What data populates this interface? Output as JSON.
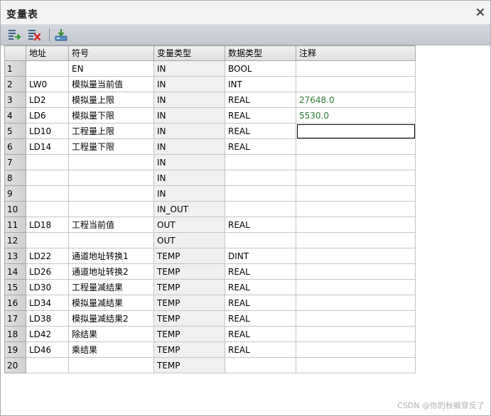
{
  "window": {
    "title": "变量表"
  },
  "table": {
    "headers": [
      "",
      "地址",
      "符号",
      "变量类型",
      "数据类型",
      "注释"
    ],
    "rows": [
      {
        "num": "1",
        "address": "",
        "symbol": "EN",
        "var_type": "IN",
        "data_type": "BOOL",
        "comment": ""
      },
      {
        "num": "2",
        "address": "LW0",
        "symbol": "模拟量当前值",
        "var_type": "IN",
        "data_type": "INT",
        "comment": ""
      },
      {
        "num": "3",
        "address": "LD2",
        "symbol": "模拟量上限",
        "var_type": "IN",
        "data_type": "REAL",
        "comment": "27648.0"
      },
      {
        "num": "4",
        "address": "LD6",
        "symbol": "模拟量下限",
        "var_type": "IN",
        "data_type": "REAL",
        "comment": "5530.0"
      },
      {
        "num": "5",
        "address": "LD10",
        "symbol": "工程量上限",
        "var_type": "IN",
        "data_type": "REAL",
        "comment": ""
      },
      {
        "num": "6",
        "address": "LD14",
        "symbol": "工程量下限",
        "var_type": "IN",
        "data_type": "REAL",
        "comment": ""
      },
      {
        "num": "7",
        "address": "",
        "symbol": "",
        "var_type": "IN",
        "data_type": "",
        "comment": ""
      },
      {
        "num": "8",
        "address": "",
        "symbol": "",
        "var_type": "IN",
        "data_type": "",
        "comment": ""
      },
      {
        "num": "9",
        "address": "",
        "symbol": "",
        "var_type": "IN",
        "data_type": "",
        "comment": ""
      },
      {
        "num": "10",
        "address": "",
        "symbol": "",
        "var_type": "IN_OUT",
        "data_type": "",
        "comment": ""
      },
      {
        "num": "11",
        "address": "LD18",
        "symbol": "工程当前值",
        "var_type": "OUT",
        "data_type": "REAL",
        "comment": ""
      },
      {
        "num": "12",
        "address": "",
        "symbol": "",
        "var_type": "OUT",
        "data_type": "",
        "comment": ""
      },
      {
        "num": "13",
        "address": "LD22",
        "symbol": "通道地址转换1",
        "var_type": "TEMP",
        "data_type": "DINT",
        "comment": ""
      },
      {
        "num": "14",
        "address": "LD26",
        "symbol": "通道地址转换2",
        "var_type": "TEMP",
        "data_type": "REAL",
        "comment": ""
      },
      {
        "num": "15",
        "address": "LD30",
        "symbol": "工程量减结果",
        "var_type": "TEMP",
        "data_type": "REAL",
        "comment": ""
      },
      {
        "num": "16",
        "address": "LD34",
        "symbol": "模拟量减结果",
        "var_type": "TEMP",
        "data_type": "REAL",
        "comment": ""
      },
      {
        "num": "17",
        "address": "LD38",
        "symbol": "模拟量减结果2",
        "var_type": "TEMP",
        "data_type": "REAL",
        "comment": ""
      },
      {
        "num": "18",
        "address": "LD42",
        "symbol": "除结果",
        "var_type": "TEMP",
        "data_type": "REAL",
        "comment": ""
      },
      {
        "num": "19",
        "address": "LD46",
        "symbol": "乘结果",
        "var_type": "TEMP",
        "data_type": "REAL",
        "comment": ""
      },
      {
        "num": "20",
        "address": "",
        "symbol": "",
        "var_type": "TEMP",
        "data_type": "",
        "comment": ""
      }
    ]
  },
  "toolbar": {
    "buttons": [
      {
        "name": "insert-row-icon"
      },
      {
        "name": "delete-row-icon"
      },
      {
        "name": "download-icon"
      }
    ]
  },
  "watermark": "CSDN @你的秋裤穿反了",
  "colors": {
    "comment_value": "#2e7d32",
    "toolbar_bg": "#c9cdd4"
  }
}
